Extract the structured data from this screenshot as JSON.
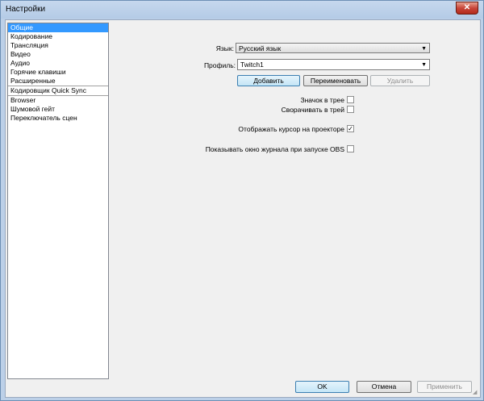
{
  "window": {
    "title": "Настройки",
    "close_glyph": "✕"
  },
  "sidebar": {
    "items": [
      {
        "label": "Общие",
        "selected": true
      },
      {
        "label": "Кодирование"
      },
      {
        "label": "Трансляция"
      },
      {
        "label": "Видео"
      },
      {
        "label": "Аудио"
      },
      {
        "label": "Горячие клавиши"
      },
      {
        "label": "Расширенные"
      },
      {
        "label": "Кодировщик Quick Sync"
      },
      {
        "label": "Browser"
      },
      {
        "label": "Шумовой гейт"
      },
      {
        "label": "Переключатель сцен"
      }
    ]
  },
  "general": {
    "language_label": "Язык:",
    "language_value": "Русский язык",
    "profile_label": "Профиль:",
    "profile_value": "Twitch1",
    "add_label": "Добавить",
    "rename_label": "Переименовать",
    "delete_label": "Удалить",
    "tray_icon_label": "Значок в трее",
    "tray_icon_checked": false,
    "minimize_tray_label": "Сворачивать в трей",
    "minimize_tray_checked": false,
    "projector_cursor_label": "Отображать курсор на проекторе",
    "projector_cursor_checked": true,
    "show_log_label": "Показывать окно журнала при запуске OBS",
    "show_log_checked": false
  },
  "footer": {
    "ok_label": "OK",
    "cancel_label": "Отмена",
    "apply_label": "Применить"
  },
  "glyphs": {
    "dropdown_arrow": "▼",
    "check_mark": "✓"
  },
  "icons": {
    "close": "close-icon",
    "dropdown": "chevron-down-icon",
    "check": "check-icon"
  }
}
